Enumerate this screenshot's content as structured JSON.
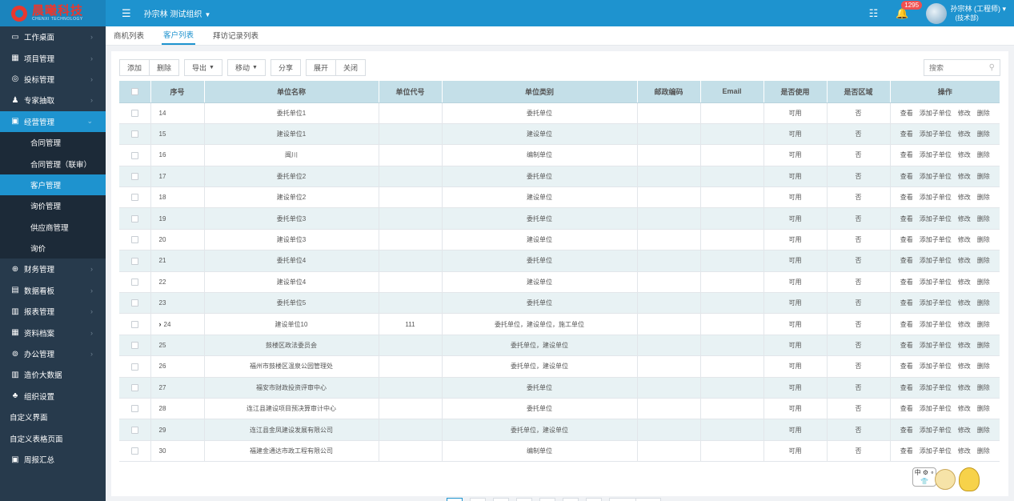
{
  "header": {
    "logo_cn": "晨曦科技",
    "logo_en": "CHENXI TECHNOLOGY",
    "org_name": "孙宗林 测试组织",
    "notification_count": "1295",
    "user_name": "孙宗林 (工程师)",
    "user_dept": "(技术部)"
  },
  "sidebar": {
    "items": [
      {
        "label": "工作桌面",
        "icon": "monitor-icon"
      },
      {
        "label": "项目管理",
        "icon": "building-icon"
      },
      {
        "label": "投标管理",
        "icon": "target-icon"
      },
      {
        "label": "专家抽取",
        "icon": "users-icon"
      },
      {
        "label": "经营管理",
        "icon": "briefcase-icon"
      },
      {
        "label": "财务管理",
        "icon": "money-bag-icon"
      },
      {
        "label": "数据看板",
        "icon": "dashboard-icon"
      },
      {
        "label": "报表管理",
        "icon": "bar-chart-icon"
      },
      {
        "label": "资料档案",
        "icon": "archive-icon"
      },
      {
        "label": "办公管理",
        "icon": "office-icon"
      },
      {
        "label": "造价大数据",
        "icon": "data-chart-icon"
      },
      {
        "label": "组织设置",
        "icon": "org-icon"
      }
    ],
    "sub_items": [
      "合同管理",
      "合同管理（联审）",
      "客户管理",
      "询价管理",
      "供应商管理",
      "询价"
    ],
    "extra": [
      "自定义界面",
      "自定义表格页面"
    ],
    "report_summary": "周报汇总"
  },
  "tabs": [
    "商机列表",
    "客户列表",
    "拜访记录列表"
  ],
  "toolbar": {
    "add": "添加",
    "delete": "删除",
    "export": "导出",
    "move": "移动",
    "share": "分享",
    "expand": "展开",
    "close": "关闭",
    "search_placeholder": "搜索"
  },
  "table": {
    "headers": [
      "序号",
      "单位名称",
      "单位代号",
      "单位类别",
      "邮政编码",
      "Email",
      "是否使用",
      "是否区域",
      "操作"
    ],
    "ops": [
      "查看",
      "添加子单位",
      "修改",
      "删除"
    ],
    "rows": [
      {
        "no": "14",
        "name": "委托单位1",
        "code": "",
        "type": "委托单位",
        "zip": "",
        "email": "",
        "used": "可用",
        "region": "否"
      },
      {
        "no": "15",
        "name": "建设单位1",
        "code": "",
        "type": "建设单位",
        "zip": "",
        "email": "",
        "used": "可用",
        "region": "否"
      },
      {
        "no": "16",
        "name": "闽川",
        "code": "",
        "type": "编制单位",
        "zip": "",
        "email": "",
        "used": "可用",
        "region": "否"
      },
      {
        "no": "17",
        "name": "委托单位2",
        "code": "",
        "type": "委托单位",
        "zip": "",
        "email": "",
        "used": "可用",
        "region": "否"
      },
      {
        "no": "18",
        "name": "建设单位2",
        "code": "",
        "type": "建设单位",
        "zip": "",
        "email": "",
        "used": "可用",
        "region": "否"
      },
      {
        "no": "19",
        "name": "委托单位3",
        "code": "",
        "type": "委托单位",
        "zip": "",
        "email": "",
        "used": "可用",
        "region": "否"
      },
      {
        "no": "20",
        "name": "建设单位3",
        "code": "",
        "type": "建设单位",
        "zip": "",
        "email": "",
        "used": "可用",
        "region": "否"
      },
      {
        "no": "21",
        "name": "委托单位4",
        "code": "",
        "type": "委托单位",
        "zip": "",
        "email": "",
        "used": "可用",
        "region": "否"
      },
      {
        "no": "22",
        "name": "建设单位4",
        "code": "",
        "type": "建设单位",
        "zip": "",
        "email": "",
        "used": "可用",
        "region": "否"
      },
      {
        "no": "23",
        "name": "委托单位5",
        "code": "",
        "type": "委托单位",
        "zip": "",
        "email": "",
        "used": "可用",
        "region": "否"
      },
      {
        "no": "24",
        "name": "建设单位10",
        "code": "111",
        "type": "委托单位，建设单位，施工单位",
        "zip": "",
        "email": "",
        "used": "可用",
        "region": "否",
        "expandable": true
      },
      {
        "no": "25",
        "name": "鼓楼区政法委员会",
        "code": "",
        "type": "委托单位，建设单位",
        "zip": "",
        "email": "",
        "used": "可用",
        "region": "否"
      },
      {
        "no": "26",
        "name": "福州市鼓楼区温泉公园管理处",
        "code": "",
        "type": "委托单位，建设单位",
        "zip": "",
        "email": "",
        "used": "可用",
        "region": "否"
      },
      {
        "no": "27",
        "name": "福安市财政投资评审中心",
        "code": "",
        "type": "委托单位",
        "zip": "",
        "email": "",
        "used": "可用",
        "region": "否"
      },
      {
        "no": "28",
        "name": "连江县建设项目预决算审计中心",
        "code": "",
        "type": "委托单位",
        "zip": "",
        "email": "",
        "used": "可用",
        "region": "否"
      },
      {
        "no": "29",
        "name": "连江县金凤建设发展有限公司",
        "code": "",
        "type": "委托单位，建设单位",
        "zip": "",
        "email": "",
        "used": "可用",
        "region": "否"
      },
      {
        "no": "30",
        "name": "福建金通达市政工程有限公司",
        "code": "",
        "type": "编制单位",
        "zip": "",
        "email": "",
        "used": "可用",
        "region": "否"
      }
    ]
  },
  "pager": {
    "pages": [
      "1",
      "2",
      "3",
      "4",
      "5",
      "...",
      "14"
    ],
    "jump_value": "1",
    "jump_label": "跳转"
  },
  "mascot_text": "中 ⚙ ∘ 👕"
}
